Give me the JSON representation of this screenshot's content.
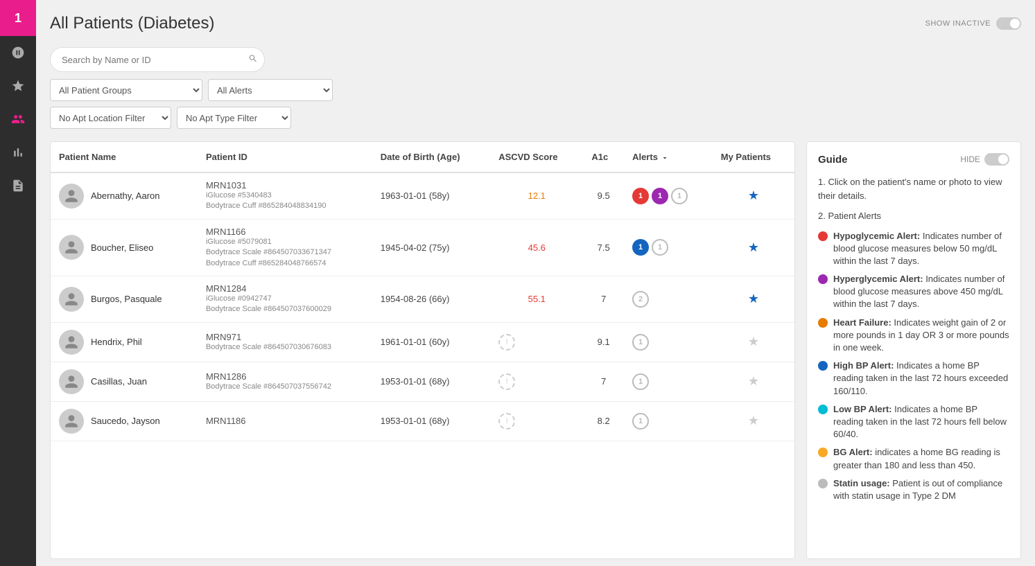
{
  "app": {
    "logo": "1",
    "title": "All Patients (Diabetes)"
  },
  "header": {
    "show_inactive_label": "SHOW INACTIVE"
  },
  "search": {
    "placeholder": "Search by Name or ID"
  },
  "filters": {
    "patient_groups_options": [
      "All Patient Groups"
    ],
    "patient_groups_selected": "All Patient Groups",
    "alerts_options": [
      "All Alerts"
    ],
    "alerts_selected": "All Alerts",
    "apt_location_options": [
      "No Apt Location Filter"
    ],
    "apt_location_selected": "No Apt Location Filter",
    "apt_type_options": [
      "No Apt Type Filter"
    ],
    "apt_type_selected": "No Apt Type Filter"
  },
  "table": {
    "columns": [
      "Patient Name",
      "Patient ID",
      "Date of Birth (Age)",
      "ASCVD Score",
      "A1c",
      "Alerts",
      "My Patients"
    ],
    "patients": [
      {
        "name": "Abernathy, Aaron",
        "mrn": "MRN1031",
        "devices": [
          "iGlucose #5340483",
          "Bodytrace Cuff #865284048834190"
        ],
        "dob": "1963-01-01 (58y)",
        "ascvd": "12.1",
        "ascvd_color": "orange",
        "a1c": "9.5",
        "alerts": [
          {
            "type": "red",
            "count": "1"
          },
          {
            "type": "purple",
            "count": "1"
          },
          {
            "type": "gray",
            "count": "1"
          }
        ],
        "my_patient": true
      },
      {
        "name": "Boucher, Eliseo",
        "mrn": "MRN1166",
        "devices": [
          "iGlucose #5079081",
          "Bodytrace Scale #864507033671347",
          "Bodytrace Cuff #865284048766574"
        ],
        "dob": "1945-04-02 (75y)",
        "ascvd": "45.6",
        "ascvd_color": "red",
        "a1c": "7.5",
        "alerts": [
          {
            "type": "blue",
            "count": "1"
          },
          {
            "type": "gray",
            "count": "1"
          }
        ],
        "my_patient": true
      },
      {
        "name": "Burgos, Pasquale",
        "mrn": "MRN1284",
        "devices": [
          "iGlucose #0942747",
          "Bodytrace Scale #864507037600029"
        ],
        "dob": "1954-08-26 (66y)",
        "ascvd": "55.1",
        "ascvd_color": "red",
        "a1c": "7",
        "alerts": [
          {
            "type": "gray-num",
            "count": "2"
          }
        ],
        "my_patient": true
      },
      {
        "name": "Hendrix, Phil",
        "mrn": "MRN971",
        "devices": [
          "Bodytrace Scale #864507030676083"
        ],
        "dob": "1961-01-01 (60y)",
        "ascvd": "",
        "ascvd_color": "",
        "a1c": "9.1",
        "alerts": [
          {
            "type": "gray-num",
            "count": "1"
          }
        ],
        "my_patient": false
      },
      {
        "name": "Casillas, Juan",
        "mrn": "MRN1286",
        "devices": [
          "Bodytrace Scale #864507037556742"
        ],
        "dob": "1953-01-01 (68y)",
        "ascvd": "",
        "ascvd_color": "",
        "a1c": "7",
        "alerts": [
          {
            "type": "gray-num",
            "count": "1"
          }
        ],
        "my_patient": false
      },
      {
        "name": "Saucedo, Jayson",
        "mrn": "MRN1186",
        "devices": [],
        "dob": "1953-01-01 (68y)",
        "ascvd": "",
        "ascvd_color": "",
        "a1c": "8.2",
        "alerts": [
          {
            "type": "gray-num",
            "count": "1"
          }
        ],
        "my_patient": false
      }
    ]
  },
  "guide": {
    "title": "Guide",
    "hide_label": "HIDE",
    "steps": [
      "Click on the patient's name or photo to view their details.",
      "Patient Alerts"
    ],
    "alerts": [
      {
        "color": "red",
        "label": "Hypoglycemic Alert:",
        "desc": "Indicates number of blood glucose measures below 50 mg/dL within the last 7 days."
      },
      {
        "color": "purple",
        "label": "Hyperglycemic Alert:",
        "desc": "Indicates number of blood glucose measures above 450 mg/dL within the last 7 days."
      },
      {
        "color": "orange",
        "label": "Heart Failure:",
        "desc": "Indicates weight gain of 2 or more pounds in 1 day OR 3 or more pounds in one week."
      },
      {
        "color": "darkblue",
        "label": "High BP Alert:",
        "desc": "Indicates a home BP reading taken in the last 72 hours exceeded 160/110."
      },
      {
        "color": "cyan",
        "label": "Low BP Alert:",
        "desc": "Indicates a home BP reading taken in the last 72 hours fell below 60/40."
      },
      {
        "color": "yellow",
        "label": "BG Alert:",
        "desc": "indicates a home BG reading is greater than 180 and less than 450."
      },
      {
        "color": "gray",
        "label": "Statin usage:",
        "desc": "Patient is out of compliance with statin usage in Type 2 DM"
      }
    ]
  },
  "sidebar": {
    "icons": [
      "dashboard",
      "star",
      "patients",
      "chart",
      "document"
    ]
  }
}
